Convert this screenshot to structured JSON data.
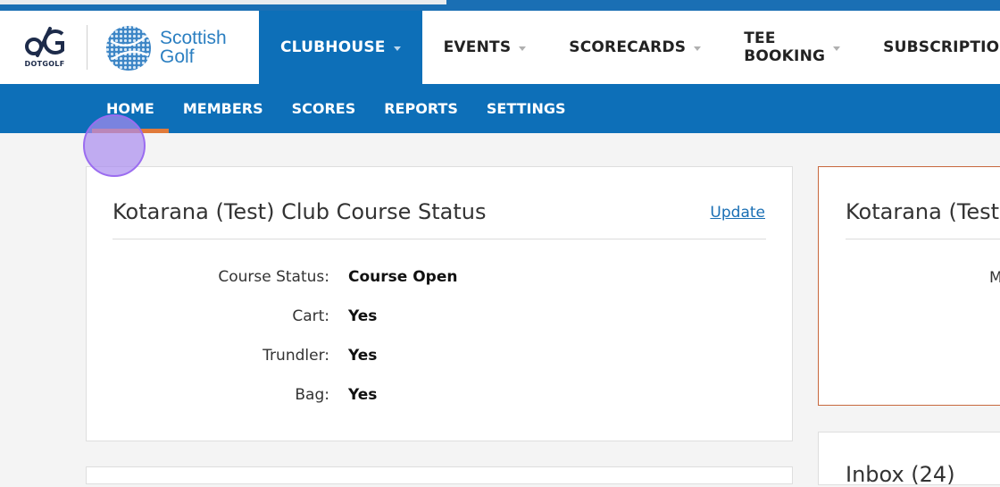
{
  "brand": {
    "dotgolf_label": "DOTGOLF",
    "dotgolf_icon": "dotgolf-logo-icon",
    "scottish_line1": "Scottish",
    "scottish_line2": "Golf",
    "scottish_icon": "golf-ball-logo-icon",
    "primary_color": "#0d6fb8",
    "accent_color": "#e07a3a"
  },
  "nav": {
    "items": [
      {
        "label": "CLUBHOUSE",
        "active": true,
        "dropdown": true
      },
      {
        "label": "EVENTS",
        "active": false,
        "dropdown": true
      },
      {
        "label": "SCORECARDS",
        "active": false,
        "dropdown": true
      },
      {
        "label": "TEE BOOKING",
        "active": false,
        "dropdown": true
      },
      {
        "label": "SUBSCRIPTIONS",
        "active": false,
        "dropdown": false
      }
    ]
  },
  "subnav": {
    "items": [
      {
        "label": "HOME",
        "active": true
      },
      {
        "label": "MEMBERS",
        "active": false
      },
      {
        "label": "SCORES",
        "active": false
      },
      {
        "label": "REPORTS",
        "active": false
      },
      {
        "label": "SETTINGS",
        "active": false
      }
    ]
  },
  "course_status": {
    "title": "Kotarana (Test) Club Course Status",
    "update_link": "Update",
    "rows": [
      {
        "label": "Course Status:",
        "value": "Course Open"
      },
      {
        "label": "Cart:",
        "value": "Yes"
      },
      {
        "label": "Trundler:",
        "value": "Yes"
      },
      {
        "label": "Bag:",
        "value": "Yes"
      }
    ]
  },
  "side_card": {
    "title": "Kotarana (Test",
    "partial_text": "M"
  },
  "side_card_2": {
    "title": "Inbox (24)"
  }
}
